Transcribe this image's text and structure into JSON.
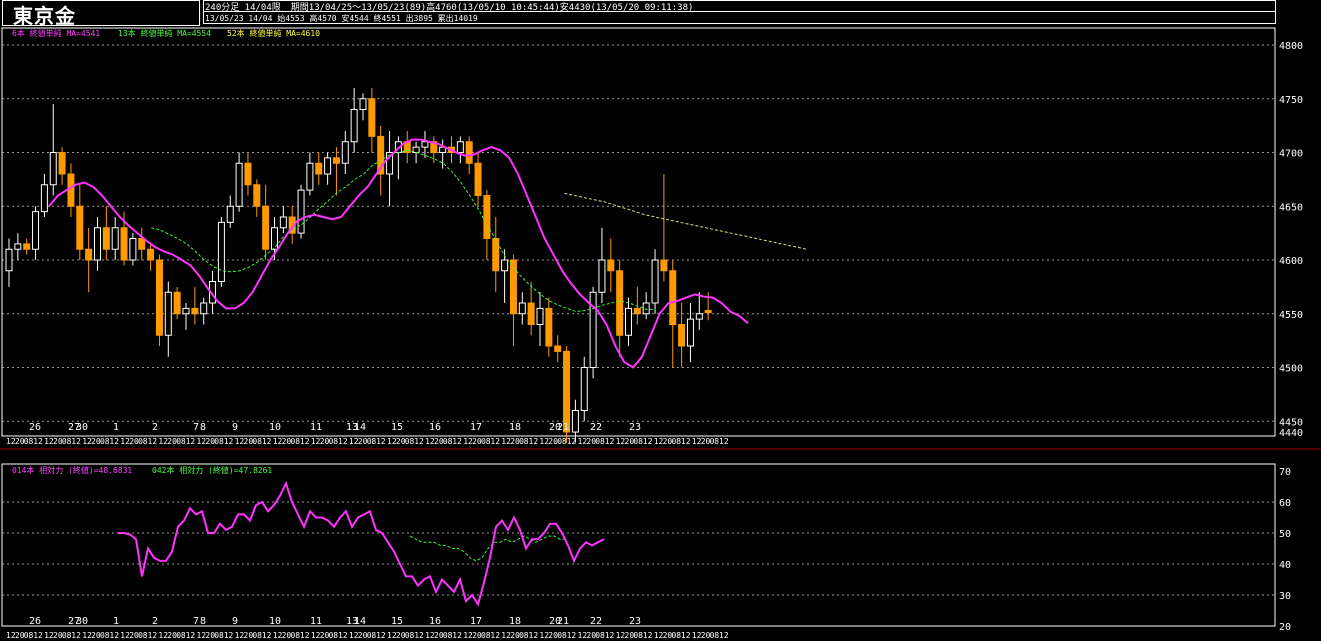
{
  "header": {
    "title": "東京金",
    "timeframe": "240分足 14/04限",
    "period": "期間13/04/25～13/05/23(89)高4760(13/05/10 10:45:44)安4430(13/05/20 09:11:38)",
    "last_bar": "13/05/23 14/04 始4553 高4570 安4544 終4551 出3895 累出14019"
  },
  "legend_top": [
    {
      "text": "6本 終値単純 MA=4541",
      "color": "#ff44ff"
    },
    {
      "text": "13本 終値単純 MA=4554",
      "color": "#44ff44"
    },
    {
      "text": "52本 終値単純 MA=4610",
      "color": "#ffff44"
    }
  ],
  "legend_bottom": [
    {
      "text": "014本 相対力 (終値)=48.6831",
      "color": "#ff44ff"
    },
    {
      "text": "042本 相対力 (終値)=47.8261",
      "color": "#44ff44"
    }
  ],
  "colors": {
    "up": "#ffffff",
    "down": "#ff9900",
    "ma6": "#ff33ff",
    "ma13": "#33ff33",
    "ma52": "#dddd88",
    "rsi14": "#ff33ff",
    "rsi42": "#33ff33",
    "grid": "#ffffff"
  },
  "chart_data": [
    {
      "type": "candlestick",
      "yticks": [
        4440,
        4450,
        4500,
        4550,
        4600,
        4650,
        4700,
        4750,
        4800
      ],
      "ylim": [
        4440,
        4800
      ],
      "date_labels": [
        "26",
        "27",
        "30",
        "1",
        "2",
        "7",
        "8",
        "9",
        "10",
        "11",
        "13",
        "14",
        "15",
        "16",
        "17",
        "18",
        "20",
        "21",
        "22",
        "23"
      ],
      "session_labels": [
        "12",
        "20",
        "0",
        "8",
        "12"
      ],
      "candles": [
        [
          4590,
          4620,
          4575,
          4610
        ],
        [
          4610,
          4625,
          4600,
          4615
        ],
        [
          4615,
          4620,
          4605,
          4610
        ],
        [
          4610,
          4650,
          4600,
          4645
        ],
        [
          4645,
          4680,
          4640,
          4670
        ],
        [
          4670,
          4745,
          4660,
          4700
        ],
        [
          4700,
          4705,
          4670,
          4680
        ],
        [
          4680,
          4690,
          4640,
          4650
        ],
        [
          4650,
          4670,
          4600,
          4610
        ],
        [
          4610,
          4630,
          4570,
          4600
        ],
        [
          4600,
          4640,
          4590,
          4630
        ],
        [
          4630,
          4650,
          4600,
          4610
        ],
        [
          4610,
          4640,
          4600,
          4630
        ],
        [
          4630,
          4645,
          4595,
          4600
        ],
        [
          4600,
          4625,
          4595,
          4620
        ],
        [
          4620,
          4630,
          4600,
          4610
        ],
        [
          4610,
          4615,
          4590,
          4600
        ],
        [
          4600,
          4605,
          4520,
          4530
        ],
        [
          4530,
          4580,
          4510,
          4570
        ],
        [
          4570,
          4575,
          4545,
          4550
        ],
        [
          4550,
          4560,
          4535,
          4555
        ],
        [
          4555,
          4575,
          4540,
          4550
        ],
        [
          4550,
          4565,
          4540,
          4560
        ],
        [
          4560,
          4590,
          4550,
          4580
        ],
        [
          4580,
          4640,
          4575,
          4635
        ],
        [
          4635,
          4660,
          4630,
          4650
        ],
        [
          4650,
          4700,
          4645,
          4690
        ],
        [
          4690,
          4700,
          4660,
          4670
        ],
        [
          4670,
          4675,
          4640,
          4650
        ],
        [
          4650,
          4670,
          4600,
          4610
        ],
        [
          4610,
          4640,
          4600,
          4630
        ],
        [
          4630,
          4650,
          4625,
          4640
        ],
        [
          4640,
          4650,
          4615,
          4625
        ],
        [
          4625,
          4670,
          4620,
          4665
        ],
        [
          4665,
          4700,
          4660,
          4690
        ],
        [
          4690,
          4700,
          4670,
          4680
        ],
        [
          4680,
          4700,
          4670,
          4695
        ],
        [
          4695,
          4705,
          4660,
          4690
        ],
        [
          4690,
          4720,
          4680,
          4710
        ],
        [
          4710,
          4760,
          4700,
          4740
        ],
        [
          4740,
          4755,
          4730,
          4750
        ],
        [
          4750,
          4760,
          4700,
          4715
        ],
        [
          4715,
          4725,
          4660,
          4680
        ],
        [
          4680,
          4720,
          4650,
          4700
        ],
        [
          4700,
          4715,
          4675,
          4710
        ],
        [
          4710,
          4720,
          4690,
          4700
        ],
        [
          4700,
          4710,
          4690,
          4705
        ],
        [
          4705,
          4720,
          4695,
          4710
        ],
        [
          4710,
          4715,
          4690,
          4700
        ],
        [
          4700,
          4712,
          4685,
          4705
        ],
        [
          4705,
          4715,
          4690,
          4700
        ],
        [
          4700,
          4715,
          4690,
          4710
        ],
        [
          4710,
          4715,
          4680,
          4690
        ],
        [
          4690,
          4700,
          4650,
          4660
        ],
        [
          4660,
          4665,
          4600,
          4620
        ],
        [
          4620,
          4640,
          4570,
          4590
        ],
        [
          4590,
          4610,
          4560,
          4600
        ],
        [
          4600,
          4605,
          4520,
          4550
        ],
        [
          4550,
          4570,
          4540,
          4560
        ],
        [
          4560,
          4580,
          4530,
          4540
        ],
        [
          4540,
          4570,
          4520,
          4555
        ],
        [
          4555,
          4565,
          4510,
          4520
        ],
        [
          4520,
          4530,
          4505,
          4515
        ],
        [
          4515,
          4520,
          4430,
          4440
        ],
        [
          4440,
          4470,
          4430,
          4460
        ],
        [
          4460,
          4510,
          4450,
          4500
        ],
        [
          4500,
          4575,
          4490,
          4570
        ],
        [
          4570,
          4630,
          4560,
          4600
        ],
        [
          4600,
          4620,
          4570,
          4590
        ],
        [
          4590,
          4600,
          4510,
          4530
        ],
        [
          4530,
          4565,
          4520,
          4555
        ],
        [
          4555,
          4575,
          4540,
          4550
        ],
        [
          4550,
          4570,
          4545,
          4560
        ],
        [
          4560,
          4610,
          4550,
          4600
        ],
        [
          4600,
          4680,
          4580,
          4590
        ],
        [
          4590,
          4600,
          4500,
          4540
        ],
        [
          4540,
          4560,
          4500,
          4520
        ],
        [
          4520,
          4560,
          4505,
          4545
        ],
        [
          4545,
          4570,
          4535,
          4550
        ],
        [
          4553,
          4570,
          4544,
          4551
        ]
      ],
      "ma6": [
        4650,
        4660,
        4665,
        4670,
        4672,
        4668,
        4660,
        4650,
        4640,
        4632,
        4625,
        4618,
        4612,
        4608,
        4605,
        4600,
        4595,
        4585,
        4573,
        4562,
        4555,
        4555,
        4560,
        4570,
        4585,
        4600,
        4612,
        4625,
        4636,
        4640,
        4642,
        4640,
        4638,
        4640,
        4650,
        4660,
        4668,
        4680,
        4692,
        4700,
        4708,
        4712,
        4712,
        4710,
        4708,
        4704,
        4700,
        4697,
        4698,
        4702,
        4705,
        4702,
        4695,
        4680,
        4660,
        4640,
        4620,
        4605,
        4590,
        4578,
        4568,
        4560,
        4553,
        4540,
        4520,
        4505,
        4500,
        4510,
        4530,
        4550,
        4560,
        4562,
        4565,
        4568,
        4566,
        4565,
        4560,
        4552,
        4548,
        4541
      ],
      "ma13": [
        null,
        null,
        null,
        null,
        null,
        null,
        null,
        null,
        null,
        null,
        null,
        null,
        4630,
        4628,
        4624,
        4620,
        4615,
        4608,
        4600,
        4594,
        4590,
        4589,
        4590,
        4593,
        4598,
        4605,
        4612,
        4622,
        4628,
        4633,
        4640,
        4648,
        4655,
        4663,
        4668,
        4675,
        4680,
        4688,
        4693,
        4698,
        4700,
        4702,
        4700,
        4697,
        4694,
        4690,
        4682,
        4672,
        4660,
        4647,
        4632,
        4618,
        4603,
        4592,
        4583,
        4575,
        4568,
        4562,
        4558,
        4555,
        4552,
        4553,
        4555,
        4558,
        4560,
        4562,
        4560,
        4557,
        4554,
        4554
      ],
      "ma52": [
        null,
        null,
        null,
        null,
        null,
        null,
        null,
        null,
        null,
        null,
        null,
        null,
        null,
        null,
        null,
        null,
        null,
        null,
        null,
        null,
        null,
        null,
        null,
        null,
        null,
        null,
        null,
        null,
        null,
        null,
        null,
        null,
        null,
        null,
        null,
        null,
        null,
        null,
        null,
        null,
        null,
        null,
        null,
        null,
        null,
        null,
        null,
        null,
        null,
        null,
        null,
        4662,
        4660,
        4658,
        4656,
        4654,
        4651,
        4648,
        4645,
        4642,
        4640,
        4638,
        4636,
        4634,
        4632,
        4630,
        4628,
        4626,
        4624,
        4622,
        4620,
        4618,
        4616,
        4614,
        4612,
        4610
      ]
    },
    {
      "type": "line",
      "yticks": [
        20,
        30,
        40,
        50,
        60,
        70
      ],
      "ylim": [
        20,
        70
      ],
      "rsi14": [
        null,
        null,
        null,
        null,
        null,
        null,
        null,
        null,
        null,
        null,
        null,
        null,
        null,
        null,
        null,
        null,
        null,
        null,
        null,
        null,
        null,
        null,
        null,
        null,
        null,
        50,
        50,
        49.5,
        48,
        36,
        45,
        42,
        41,
        41,
        44,
        52,
        54,
        58,
        56,
        57,
        50,
        50,
        53,
        51,
        52,
        56,
        56,
        54,
        59,
        60,
        57,
        59,
        62,
        66,
        60,
        56,
        52,
        57,
        55,
        55,
        54,
        52,
        55,
        57,
        52,
        55,
        56,
        57,
        51,
        50,
        47,
        44,
        40,
        36,
        36,
        33,
        35,
        36,
        31,
        35,
        33,
        31,
        35,
        28,
        30,
        27,
        34,
        42,
        52,
        54,
        51,
        55,
        51,
        45,
        48,
        48,
        50,
        53,
        53,
        50,
        46,
        41,
        45,
        47,
        46,
        47,
        48
      ],
      "rsi42": [
        null,
        null,
        null,
        null,
        null,
        null,
        null,
        null,
        null,
        null,
        null,
        null,
        null,
        null,
        null,
        null,
        null,
        null,
        null,
        null,
        null,
        null,
        null,
        null,
        null,
        null,
        null,
        null,
        null,
        null,
        null,
        null,
        null,
        null,
        null,
        null,
        null,
        null,
        null,
        null,
        null,
        null,
        null,
        null,
        null,
        null,
        null,
        null,
        null,
        null,
        null,
        null,
        null,
        null,
        null,
        null,
        null,
        null,
        null,
        null,
        null,
        null,
        null,
        null,
        null,
        null,
        null,
        null,
        null,
        null,
        null,
        null,
        49,
        48,
        47,
        47,
        47,
        46,
        46,
        45,
        45,
        44,
        42,
        41,
        42,
        45,
        47,
        47,
        48,
        47,
        48,
        49,
        48,
        47,
        48,
        49,
        49,
        48,
        48
      ]
    }
  ]
}
